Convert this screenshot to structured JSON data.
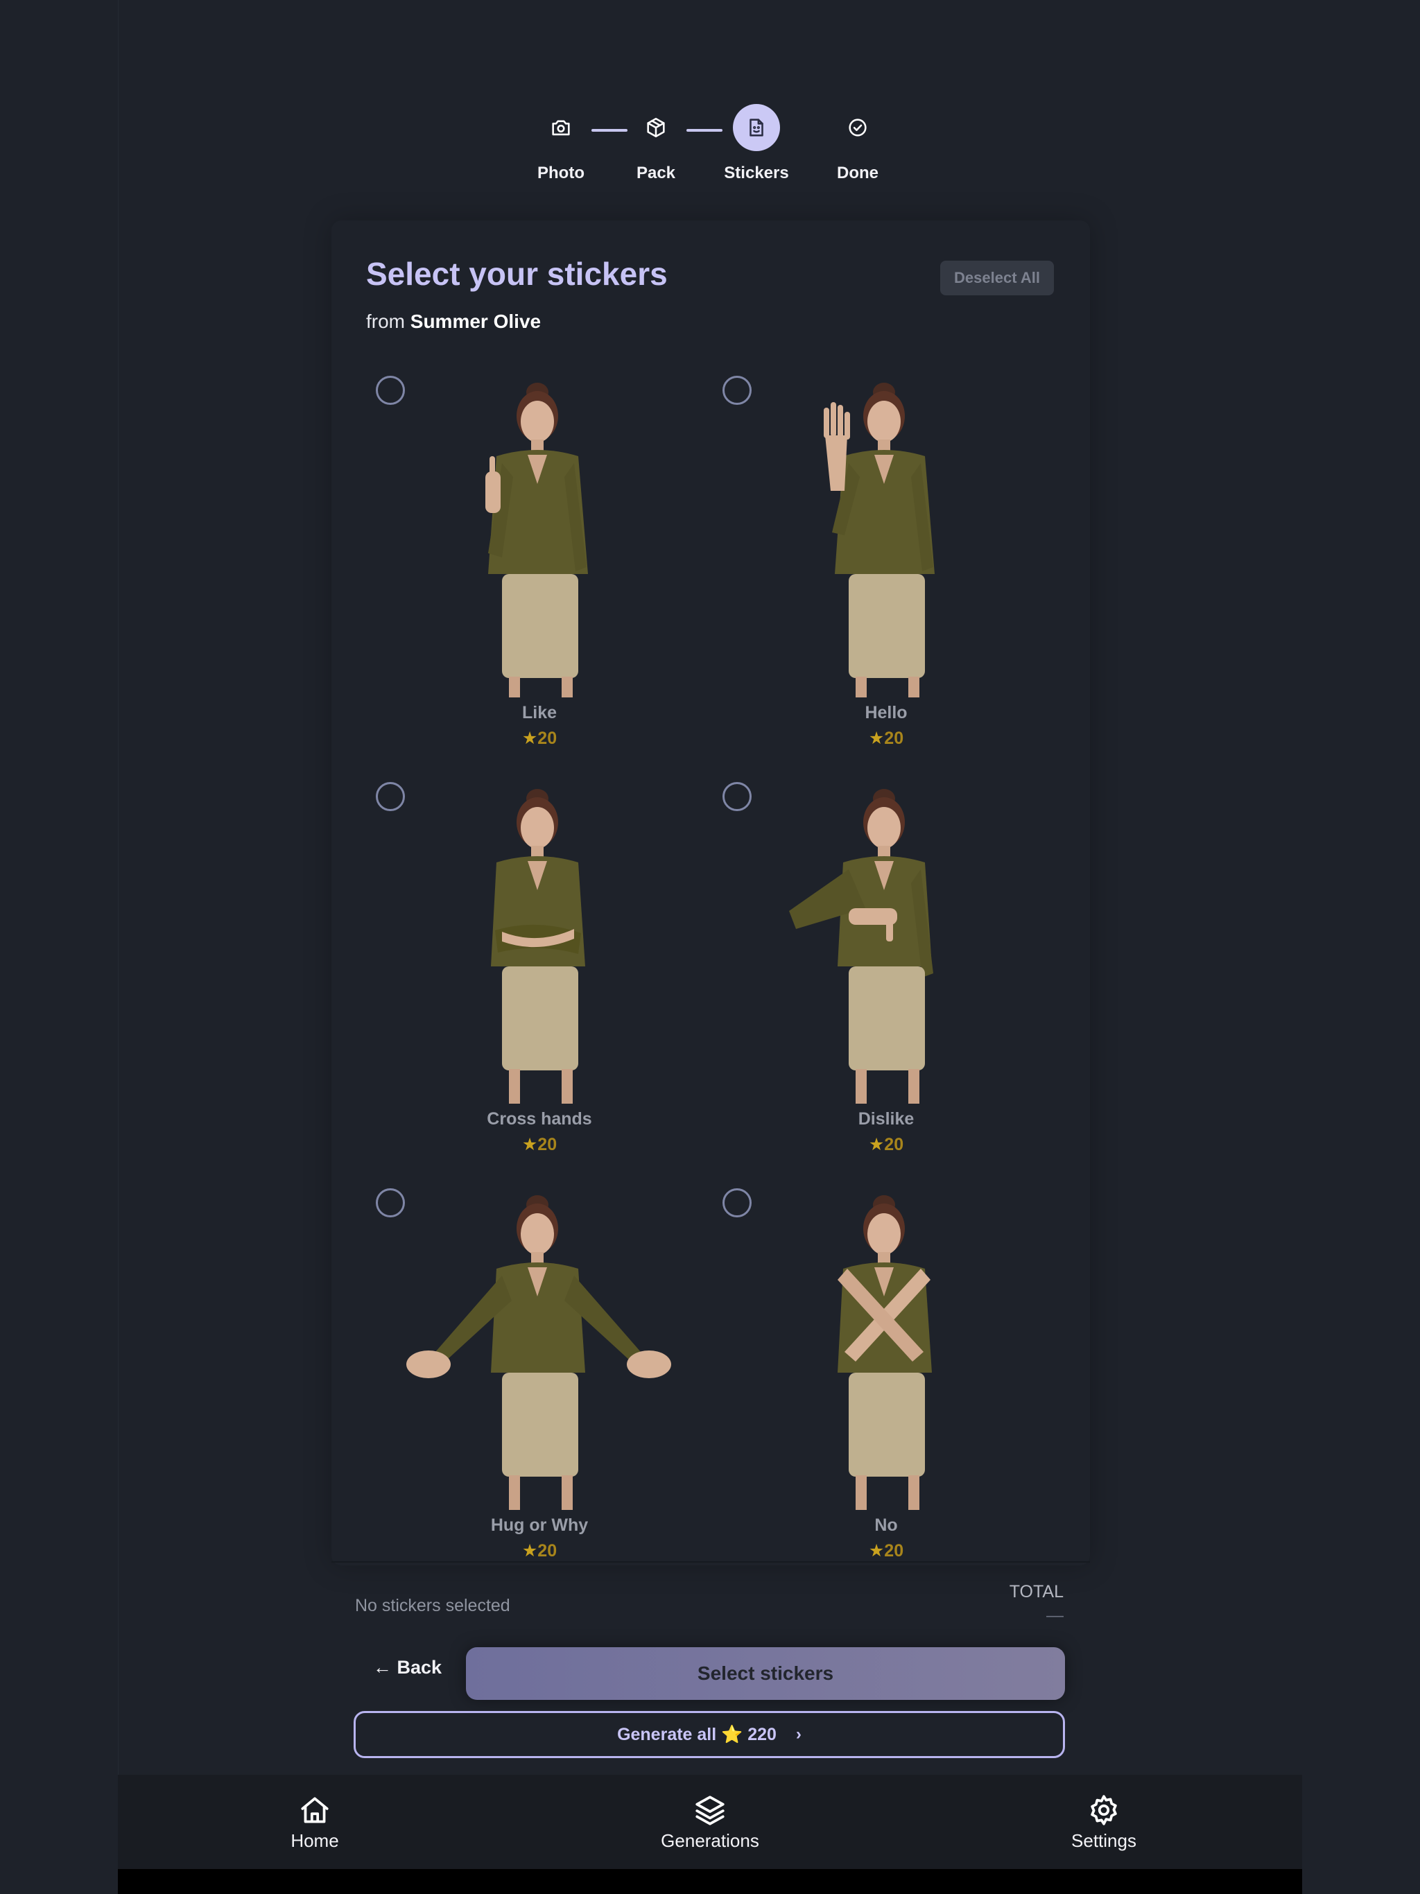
{
  "stepper": {
    "steps": [
      {
        "label": "Photo",
        "icon": "camera-icon"
      },
      {
        "label": "Pack",
        "icon": "package-icon"
      },
      {
        "label": "Stickers",
        "icon": "sticker-icon",
        "active": true
      },
      {
        "label": "Done",
        "icon": "check-circle-icon"
      }
    ]
  },
  "card": {
    "title": "Select your stickers",
    "subtitle_prefix": "from",
    "pack_name": "Summer Olive",
    "deselect_label": "Deselect All"
  },
  "stickers": [
    {
      "name": "Like",
      "price": "20",
      "pose": "thumbs-up",
      "selected": false
    },
    {
      "name": "Hello",
      "price": "20",
      "pose": "wave",
      "selected": false
    },
    {
      "name": "Cross hands",
      "price": "20",
      "pose": "arms-crossed",
      "selected": false
    },
    {
      "name": "Dislike",
      "price": "20",
      "pose": "thumbs-down",
      "selected": false
    },
    {
      "name": "Hug or Why",
      "price": "20",
      "pose": "arms-open",
      "selected": false
    },
    {
      "name": "No",
      "price": "20",
      "pose": "x-arms",
      "selected": false
    }
  ],
  "summary": {
    "selection_text": "No stickers selected",
    "total_label": "TOTAL",
    "total_value": "—"
  },
  "actions": {
    "back_label": "← Back",
    "select_label": "Select stickers",
    "generate_label": "Generate all ⭐ 220"
  },
  "nav": {
    "items": [
      {
        "label": "Home",
        "icon": "home-icon"
      },
      {
        "label": "Generations",
        "icon": "layers-icon"
      },
      {
        "label": "Settings",
        "icon": "gear-icon"
      }
    ]
  },
  "colors": {
    "background": "#1e222a",
    "accent": "#c7c3f5",
    "star": "#c9a21f"
  }
}
